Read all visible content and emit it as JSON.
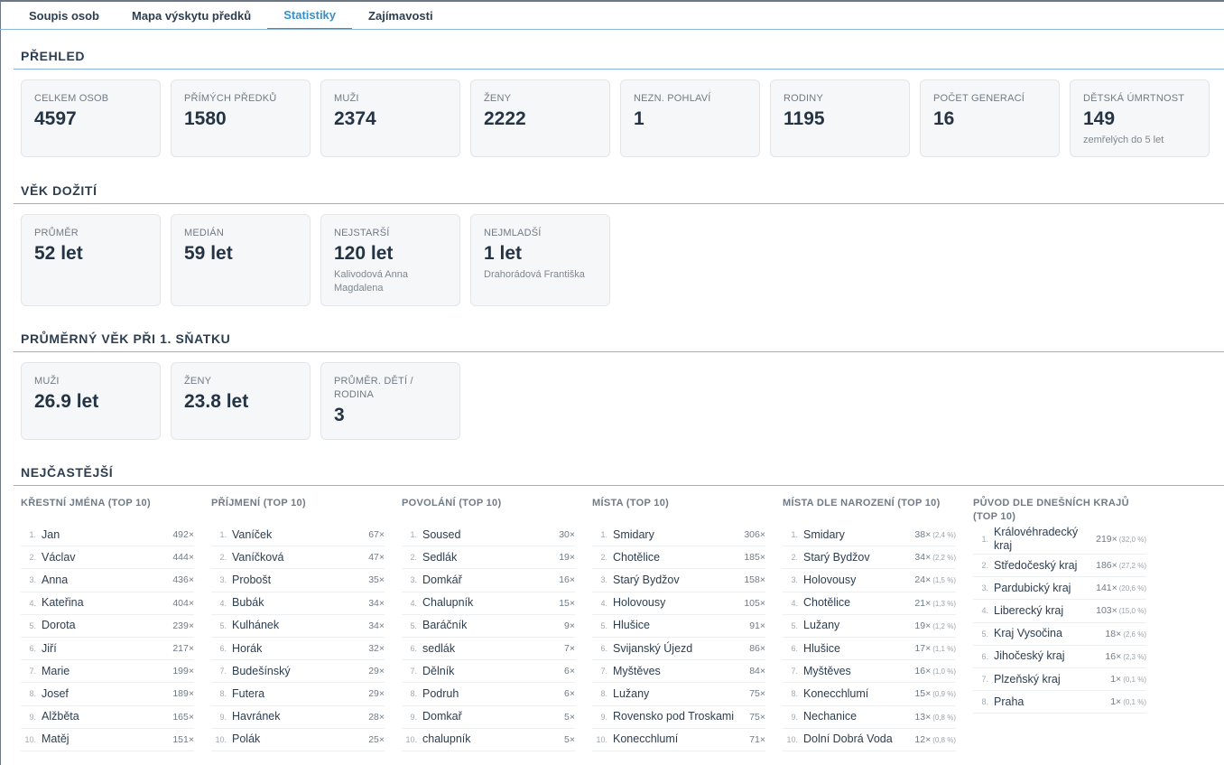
{
  "tabs": [
    {
      "label": "Soupis osob"
    },
    {
      "label": "Mapa výskytu předků"
    },
    {
      "label": "Statistiky",
      "active": true
    },
    {
      "label": "Zajímavosti"
    }
  ],
  "sections": {
    "overview": "Přehled",
    "lifespan": "Věk dožití",
    "marriage": "Průměrný věk při 1. sňatku",
    "frequent": "Nejčastější"
  },
  "overview": [
    {
      "label": "Celkem osob",
      "value": "4597"
    },
    {
      "label": "Přímých předků",
      "value": "1580"
    },
    {
      "label": "Muži",
      "value": "2374"
    },
    {
      "label": "Ženy",
      "value": "2222"
    },
    {
      "label": "Nezn. pohlaví",
      "value": "1"
    },
    {
      "label": "Rodiny",
      "value": "1195"
    },
    {
      "label": "Počet generací",
      "value": "16"
    },
    {
      "label": "Dětská úmrtnost",
      "value": "149",
      "sub": "zemřelých do 5 let"
    }
  ],
  "lifespan": [
    {
      "label": "Průměr",
      "value": "52 let"
    },
    {
      "label": "Medián",
      "value": "59 let"
    },
    {
      "label": "Nejstarší",
      "value": "120 let",
      "sub": "Kalivodová Anna Magdalena"
    },
    {
      "label": "Nejmladší",
      "value": "1 let",
      "sub": "Drahorádová Františka"
    }
  ],
  "marriage": [
    {
      "label": "Muži",
      "value": "26.9 let"
    },
    {
      "label": "Ženy",
      "value": "23.8 let"
    },
    {
      "label": "Průměr. dětí / rodina",
      "value": "3"
    }
  ],
  "top_lists": [
    {
      "title": "Křestní jména (Top 10)",
      "items": [
        {
          "n": "1.",
          "name": "Jan",
          "count": "492×"
        },
        {
          "n": "2.",
          "name": "Václav",
          "count": "444×"
        },
        {
          "n": "3.",
          "name": "Anna",
          "count": "436×"
        },
        {
          "n": "4.",
          "name": "Kateřina",
          "count": "404×"
        },
        {
          "n": "5.",
          "name": "Dorota",
          "count": "239×"
        },
        {
          "n": "6.",
          "name": "Jiří",
          "count": "217×"
        },
        {
          "n": "7.",
          "name": "Marie",
          "count": "199×"
        },
        {
          "n": "8.",
          "name": "Josef",
          "count": "189×"
        },
        {
          "n": "9.",
          "name": "Alžběta",
          "count": "165×"
        },
        {
          "n": "10.",
          "name": "Matěj",
          "count": "151×"
        }
      ]
    },
    {
      "title": "Příjmení (Top 10)",
      "items": [
        {
          "n": "1.",
          "name": "Vaníček",
          "count": "67×"
        },
        {
          "n": "2.",
          "name": "Vaníčková",
          "count": "47×"
        },
        {
          "n": "3.",
          "name": "Probošt",
          "count": "35×"
        },
        {
          "n": "4.",
          "name": "Bubák",
          "count": "34×"
        },
        {
          "n": "5.",
          "name": "Kulhánek",
          "count": "34×"
        },
        {
          "n": "6.",
          "name": "Horák",
          "count": "32×"
        },
        {
          "n": "7.",
          "name": "Budešínský",
          "count": "29×"
        },
        {
          "n": "8.",
          "name": "Futera",
          "count": "29×"
        },
        {
          "n": "9.",
          "name": "Havránek",
          "count": "28×"
        },
        {
          "n": "10.",
          "name": "Polák",
          "count": "25×"
        }
      ]
    },
    {
      "title": "Povolání (Top 10)",
      "items": [
        {
          "n": "1.",
          "name": "Soused",
          "count": "30×"
        },
        {
          "n": "2.",
          "name": "Sedlák",
          "count": "19×"
        },
        {
          "n": "3.",
          "name": "Domkář",
          "count": "16×"
        },
        {
          "n": "4.",
          "name": "Chalupník",
          "count": "15×"
        },
        {
          "n": "5.",
          "name": "Baráčník",
          "count": "9×"
        },
        {
          "n": "6.",
          "name": "sedlák",
          "count": "7×"
        },
        {
          "n": "7.",
          "name": "Dělník",
          "count": "6×"
        },
        {
          "n": "8.",
          "name": "Podruh",
          "count": "6×"
        },
        {
          "n": "9.",
          "name": "Domkař",
          "count": "5×"
        },
        {
          "n": "10.",
          "name": "chalupník",
          "count": "5×"
        }
      ]
    },
    {
      "title": "Místa (Top 10)",
      "items": [
        {
          "n": "1.",
          "name": "Smidary",
          "count": "306×"
        },
        {
          "n": "2.",
          "name": "Chotělice",
          "count": "185×"
        },
        {
          "n": "3.",
          "name": "Starý Bydžov",
          "count": "158×"
        },
        {
          "n": "4.",
          "name": "Holovousy",
          "count": "105×"
        },
        {
          "n": "5.",
          "name": "Hlušice",
          "count": "91×"
        },
        {
          "n": "6.",
          "name": "Svijanský Újezd",
          "count": "86×"
        },
        {
          "n": "7.",
          "name": "Myštěves",
          "count": "84×"
        },
        {
          "n": "8.",
          "name": "Lužany",
          "count": "75×"
        },
        {
          "n": "9.",
          "name": "Rovensko pod Troskami",
          "count": "75×"
        },
        {
          "n": "10.",
          "name": "Konecchlumí",
          "count": "71×"
        }
      ]
    },
    {
      "title": "Místa dle narození (Top 10)",
      "items": [
        {
          "n": "1.",
          "name": "Smidary",
          "count": "38×",
          "pct": "(2,4 %)"
        },
        {
          "n": "2.",
          "name": "Starý Bydžov",
          "count": "34×",
          "pct": "(2,2 %)"
        },
        {
          "n": "3.",
          "name": "Holovousy",
          "count": "24×",
          "pct": "(1,5 %)"
        },
        {
          "n": "4.",
          "name": "Chotělice",
          "count": "21×",
          "pct": "(1,3 %)"
        },
        {
          "n": "5.",
          "name": "Lužany",
          "count": "19×",
          "pct": "(1,2 %)"
        },
        {
          "n": "6.",
          "name": "Hlušice",
          "count": "17×",
          "pct": "(1,1 %)"
        },
        {
          "n": "7.",
          "name": "Myštěves",
          "count": "16×",
          "pct": "(1,0 %)"
        },
        {
          "n": "8.",
          "name": "Konecchlumí",
          "count": "15×",
          "pct": "(0,9 %)"
        },
        {
          "n": "9.",
          "name": "Nechanice",
          "count": "13×",
          "pct": "(0,8 %)"
        },
        {
          "n": "10.",
          "name": "Dolní Dobrá Voda",
          "count": "12×",
          "pct": "(0,8 %)"
        }
      ]
    },
    {
      "title": "Původ dle dnešních krajů (Top 10)",
      "items": [
        {
          "n": "1.",
          "name": "Královéhradecký kraj",
          "count": "219×",
          "pct": "(32,0 %)",
          "tall": true
        },
        {
          "n": "2.",
          "name": "Středočeský kraj",
          "count": "186×",
          "pct": "(27,2 %)"
        },
        {
          "n": "3.",
          "name": "Pardubický kraj",
          "count": "141×",
          "pct": "(20,6 %)"
        },
        {
          "n": "4.",
          "name": "Liberecký kraj",
          "count": "103×",
          "pct": "(15,0 %)"
        },
        {
          "n": "5.",
          "name": "Kraj Vysočina",
          "count": "18×",
          "pct": "(2,6 %)"
        },
        {
          "n": "6.",
          "name": "Jihočeský kraj",
          "count": "16×",
          "pct": "(2,3 %)"
        },
        {
          "n": "7.",
          "name": "Plzeňský kraj",
          "count": "1×",
          "pct": "(0,1 %)"
        },
        {
          "n": "8.",
          "name": "Praha",
          "count": "1×",
          "pct": "(0,1 %)"
        }
      ]
    }
  ]
}
